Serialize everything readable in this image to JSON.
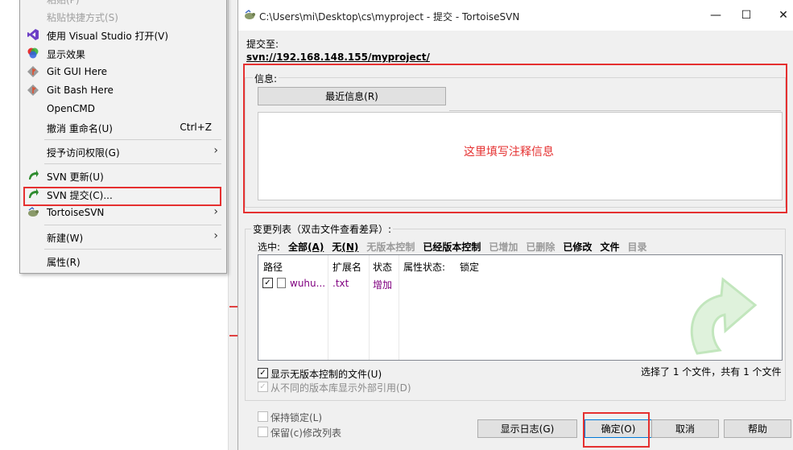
{
  "context_menu": {
    "items": [
      {
        "label": "粘贴(P)",
        "disabled": true
      },
      {
        "label": "粘贴快捷方式(S)",
        "disabled": true
      },
      {
        "label": "使用 Visual Studio 打开(V)",
        "icon": "visual-studio-icon"
      },
      {
        "label": "显示效果",
        "icon": "color-wheel-icon"
      },
      {
        "label": "Git GUI Here",
        "icon": "git-icon"
      },
      {
        "label": "Git Bash Here",
        "icon": "git-icon"
      },
      {
        "label": "OpenCMD"
      },
      {
        "label": "撤消 重命名(U)",
        "shortcut": "Ctrl+Z"
      },
      {
        "label": "授予访问权限(G)",
        "submenu": true
      },
      {
        "label": "SVN 更新(U)",
        "icon": "svn-update-icon"
      },
      {
        "label": "SVN 提交(C)...",
        "icon": "svn-commit-icon"
      },
      {
        "label": "TortoiseSVN",
        "icon": "tortoise-icon",
        "submenu": true
      },
      {
        "label": "新建(W)",
        "submenu": true
      },
      {
        "label": "属性(R)"
      }
    ]
  },
  "dialog": {
    "title": "C:\\Users\\mi\\Desktop\\cs\\myproject - 提交 - TortoiseSVN",
    "commit_to_label": "提交至:",
    "commit_url": "svn://192.168.148.155/myproject/",
    "message_label": "信息:",
    "recent_messages_button": "最近信息(R)",
    "annotation": "这里填写注释信息",
    "changes_label": "变更列表（双击文件查看差异）:",
    "select_label": "选中:",
    "filters": [
      {
        "text": "全部",
        "hotkey": "(A)",
        "enabled": true
      },
      {
        "text": "无",
        "hotkey": "(N)",
        "enabled": true
      },
      {
        "text": "无版本控制",
        "hotkey": "",
        "enabled": false
      },
      {
        "text": "已经版本控制",
        "hotkey": "",
        "enabled": true
      },
      {
        "text": "已增加",
        "hotkey": "",
        "enabled": false
      },
      {
        "text": "已删除",
        "hotkey": "",
        "enabled": false
      },
      {
        "text": "已修改",
        "hotkey": "",
        "enabled": true
      },
      {
        "text": "文件",
        "hotkey": "",
        "enabled": true
      },
      {
        "text": "目录",
        "hotkey": "",
        "enabled": false
      }
    ],
    "columns": [
      "路径",
      "扩展名",
      "状态",
      "属性状态:",
      "锁定"
    ],
    "rows": [
      {
        "path": "wuhu...",
        "ext": ".txt",
        "status": "增加",
        "checked": true
      }
    ],
    "show_unversioned": "显示无版本控制的文件(U)",
    "show_externals": "从不同的版本库显示外部引用(D)",
    "selection_summary": "选择了 1 个文件，共有 1 个文件",
    "keep_locks": "保持锁定(L)",
    "keep_changelists": "保留(c)修改列表",
    "buttons": {
      "show_log": "显示日志(G)",
      "ok": "确定(O)",
      "cancel": "取消",
      "help": "帮助"
    },
    "window_controls": {
      "minimize": "—",
      "maximize": "☐",
      "close": "✕"
    }
  },
  "colors": {
    "annotation_red": "#e53030",
    "added_status": "#800080",
    "default_button_border": "#0078d7"
  }
}
